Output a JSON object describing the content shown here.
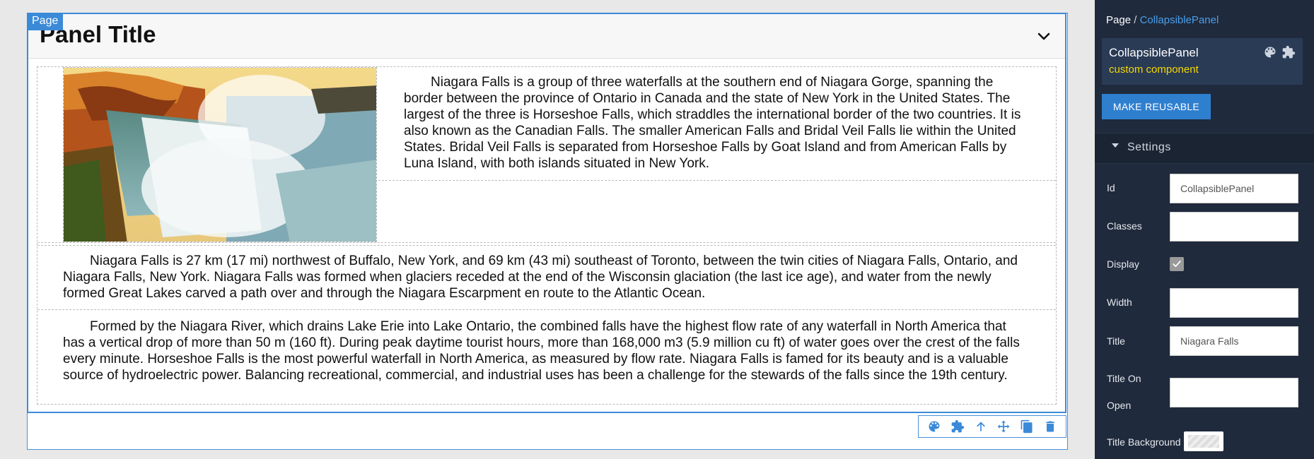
{
  "canvas": {
    "page_tag": "Page",
    "panel": {
      "title": "Panel Title",
      "image_alt": "Niagara Falls",
      "paragraphs": [
        "Niagara Falls is a group of three waterfalls at the southern end of Niagara Gorge, spanning the border between the province of Ontario in Canada and the state of New York in the United States. The largest of the three is Horseshoe Falls, which straddles the international border of the two countries. It is also known as the Canadian Falls. The smaller American Falls and Bridal Veil Falls lie within the United States. Bridal Veil Falls is separated from Horseshoe Falls by Goat Island and from American Falls by Luna Island, with both islands situated in New York.",
        "Niagara Falls is 27 km (17 mi) northwest of Buffalo, New York, and 69 km (43 mi) southeast of Toronto, between the twin cities of Niagara Falls, Ontario, and Niagara Falls, New York. Niagara Falls was formed when glaciers receded at the end of the Wisconsin glaciation (the last ice age), and water from the newly formed Great Lakes carved a path over and through the Niagara Escarpment en route to the Atlantic Ocean.",
        "Formed by the Niagara River, which drains Lake Erie into Lake Ontario, the combined falls have the highest flow rate of any waterfall in North America that has a vertical drop of more than 50 m (160 ft). During peak daytime tourist hours, more than 168,000 m3 (5.9 million cu ft) of water goes over the crest of the falls every minute. Horseshoe Falls is the most powerful waterfall in North America, as measured by flow rate. Niagara Falls is famed for its beauty and is a valuable source of hydroelectric power. Balancing recreational, commercial, and industrial uses has been a challenge for the stewards of the falls since the 19th century."
      ]
    },
    "toolbar": {
      "icons": [
        "palette-icon",
        "puzzle-icon",
        "arrow-up-icon",
        "move-icon",
        "copy-icon",
        "trash-icon"
      ]
    }
  },
  "sidebar": {
    "breadcrumb": {
      "root": "Page",
      "separator": "/",
      "current": "CollapsiblePanel"
    },
    "component": {
      "name": "CollapsiblePanel",
      "subtitle": "custom component"
    },
    "make_reusable_label": "MAKE REUSABLE",
    "settings_label": "Settings",
    "fields": {
      "id_label": "Id",
      "id_value": "CollapsiblePanel",
      "classes_label": "Classes",
      "classes_value": "",
      "display_label": "Display",
      "display_checked": true,
      "width_label": "Width",
      "width_value": "",
      "title_label": "Title",
      "title_value": "Niagara Falls",
      "title_on_open_label_1": "Title On",
      "title_on_open_label_2": "Open",
      "title_on_open_value": "",
      "title_background_label": "Title Background"
    }
  },
  "colors": {
    "accent": "#3b8ad8",
    "sidebar_bg": "#1f2a3c",
    "highlight_yellow": "#f5d800",
    "link": "#4a9eea"
  }
}
